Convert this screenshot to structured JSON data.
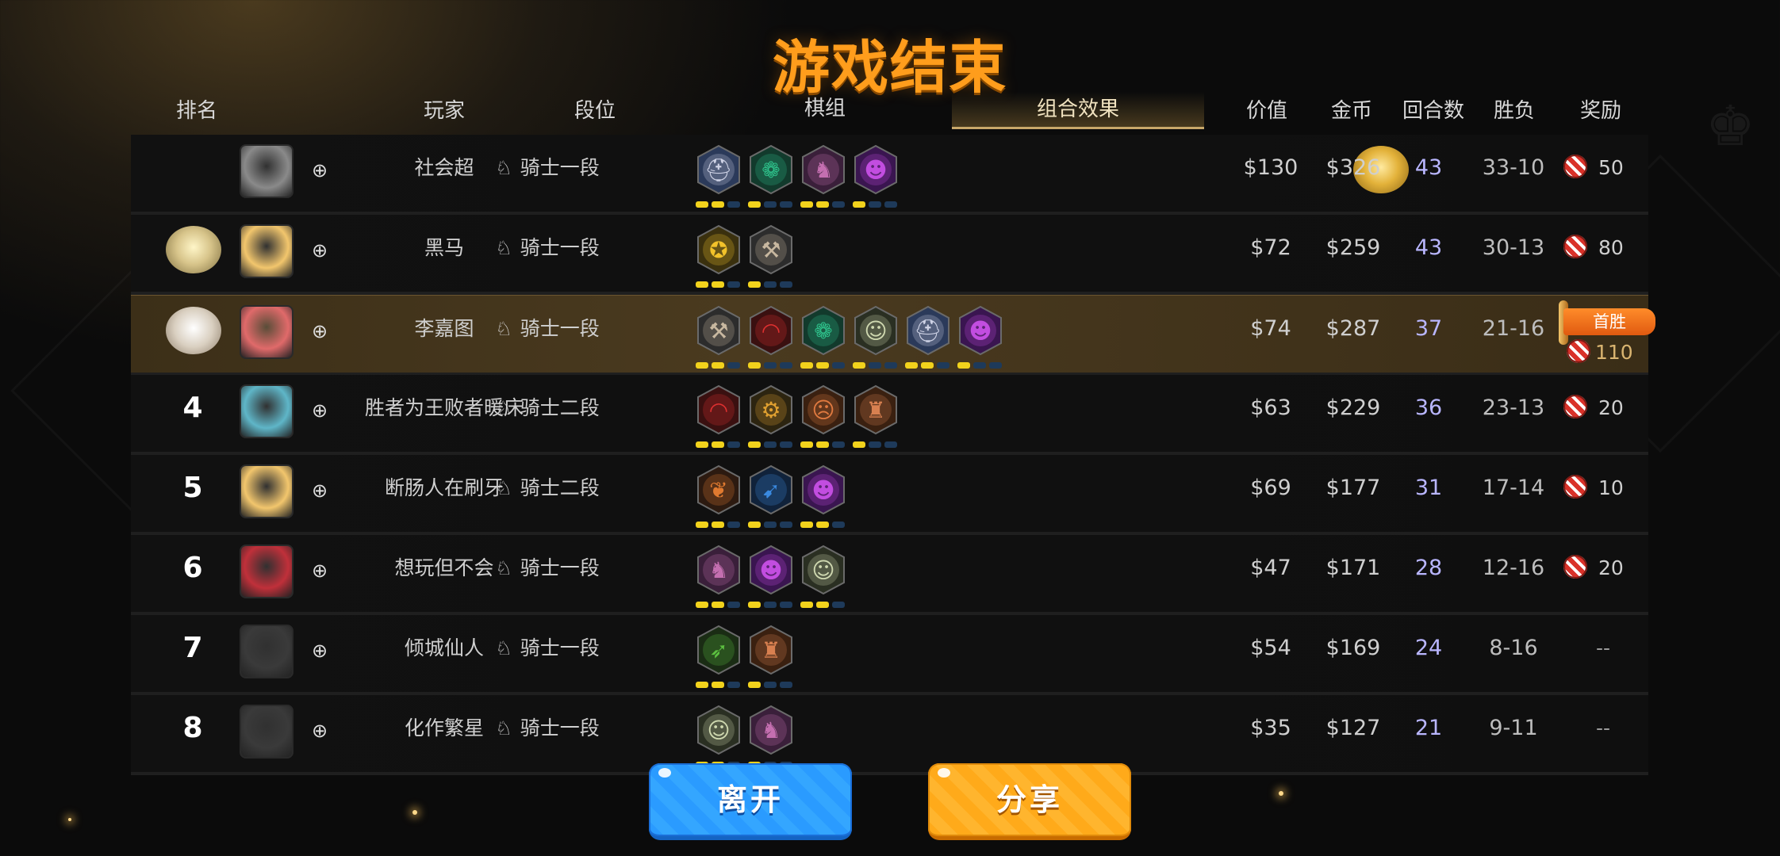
{
  "title": "游戏结束",
  "headers": {
    "rank": "排名",
    "player": "玩家",
    "tier": "段位",
    "pieces": "棋组",
    "combo": "组合效果",
    "value": "价值",
    "gold": "金币",
    "rounds": "回合数",
    "winloss": "胜负",
    "reward": "奖励"
  },
  "rows": [
    {
      "rank": "",
      "medal": "gold",
      "name": "社会超",
      "tier": "骑士一段",
      "value": "$130",
      "gold": "$326",
      "rounds": "43",
      "winloss": "33-10",
      "reward": "50",
      "avatar_color": "#8a8a8a"
    },
    {
      "rank": "",
      "medal": "silver",
      "name": "黑马",
      "tier": "骑士一段",
      "value": "$72",
      "gold": "$259",
      "rounds": "43",
      "winloss": "30-13",
      "reward": "80",
      "avatar_color": "#f2c66d"
    },
    {
      "rank": "",
      "medal": "bronze",
      "name": "李嘉图",
      "tier": "骑士一段",
      "value": "$74",
      "gold": "$287",
      "rounds": "37",
      "winloss": "21-16",
      "reward": "110",
      "first_win": "首胜",
      "avatar_color": "#e06a6a",
      "highlight": true
    },
    {
      "rank": "4",
      "name": "胜者为王败者暖床",
      "tier": "骑士二段",
      "value": "$63",
      "gold": "$229",
      "rounds": "36",
      "winloss": "23-13",
      "reward": "20",
      "avatar_color": "#5fb6c8"
    },
    {
      "rank": "5",
      "name": "断肠人在刷牙",
      "tier": "骑士二段",
      "value": "$69",
      "gold": "$177",
      "rounds": "31",
      "winloss": "17-14",
      "reward": "10",
      "avatar_color": "#f2c66d"
    },
    {
      "rank": "6",
      "name": "想玩但不会",
      "tier": "骑士一段",
      "value": "$47",
      "gold": "$171",
      "rounds": "28",
      "winloss": "12-16",
      "reward": "20",
      "avatar_color": "#c0303a"
    },
    {
      "rank": "7",
      "name": "倾城仙人",
      "tier": "骑士一段",
      "value": "$54",
      "gold": "$169",
      "rounds": "24",
      "winloss": "8-16",
      "reward": "--",
      "avatar_color": "#3a3a3a"
    },
    {
      "rank": "8",
      "name": "化作繁星",
      "tier": "骑士一段",
      "value": "$35",
      "gold": "$127",
      "rounds": "21",
      "winloss": "9-11",
      "reward": "--",
      "avatar_color": "#3a3a3a"
    }
  ],
  "traits": [
    [
      {
        "icon": "knight-helm-icon",
        "color": "#cfd3e6",
        "bg": "#2b3a5a"
      },
      {
        "icon": "paw-icon",
        "color": "#2ec08a",
        "bg": "#123a2c"
      },
      {
        "icon": "chess-knight-icon",
        "color": "#c46fb0",
        "bg": "#3a1f3a"
      },
      {
        "icon": "demon-icon",
        "color": "#c24de0",
        "bg": "#3a1550"
      }
    ],
    [
      {
        "icon": "yellow-emblem-icon",
        "color": "#f2c22a",
        "bg": "#3a300e"
      },
      {
        "icon": "hammer-icon",
        "color": "#c8b8a0",
        "bg": "#2c2c2c"
      }
    ],
    [
      {
        "icon": "hammer-icon",
        "color": "#c8b8a0",
        "bg": "#2c2c2c"
      },
      {
        "icon": "arc-icon",
        "color": "#e03030",
        "bg": "#3a1010"
      },
      {
        "icon": "paw-icon",
        "color": "#2ec08a",
        "bg": "#123a2c"
      },
      {
        "icon": "gorilla-icon",
        "color": "#cfd8b0",
        "bg": "#2a2f22"
      },
      {
        "icon": "knight-helm-icon",
        "color": "#cfd3e6",
        "bg": "#2b3a5a"
      },
      {
        "icon": "demon-icon",
        "color": "#c24de0",
        "bg": "#3a1550"
      }
    ],
    [
      {
        "icon": "arc-icon",
        "color": "#e03030",
        "bg": "#3a1010"
      },
      {
        "icon": "gear-icon",
        "color": "#e0a030",
        "bg": "#2c2410"
      },
      {
        "icon": "goblin-icon",
        "color": "#e07a40",
        "bg": "#3a2010"
      },
      {
        "icon": "viking-icon",
        "color": "#d88050",
        "bg": "#3a2010"
      }
    ],
    [
      {
        "icon": "leaf-icon",
        "color": "#e07a30",
        "bg": "#2c1a10"
      },
      {
        "icon": "feather-icon",
        "color": "#3a8ae0",
        "bg": "#10223a"
      },
      {
        "icon": "demon-icon",
        "color": "#c24de0",
        "bg": "#3a1550"
      }
    ],
    [
      {
        "icon": "chess-knight-icon",
        "color": "#c46fb0",
        "bg": "#3a1f3a"
      },
      {
        "icon": "demon-icon",
        "color": "#c24de0",
        "bg": "#3a1550"
      },
      {
        "icon": "gorilla-icon",
        "color": "#cfd8b0",
        "bg": "#2a2f22"
      }
    ],
    [
      {
        "icon": "bow-icon",
        "color": "#5cc040",
        "bg": "#1a2c14"
      },
      {
        "icon": "viking-icon",
        "color": "#d88050",
        "bg": "#3a2010"
      }
    ],
    [
      {
        "icon": "gorilla-icon",
        "color": "#cfd8b0",
        "bg": "#2a2f22"
      },
      {
        "icon": "chess-knight-icon",
        "color": "#c46fb0",
        "bg": "#3a1f3a"
      }
    ]
  ],
  "buttons": {
    "leave": "离开",
    "share": "分享"
  },
  "colors": {
    "title": "#ff9d1c",
    "rounds": "#b9b6ff",
    "bar_on": "#f2d21c",
    "bar_off": "#1e3a5a"
  }
}
